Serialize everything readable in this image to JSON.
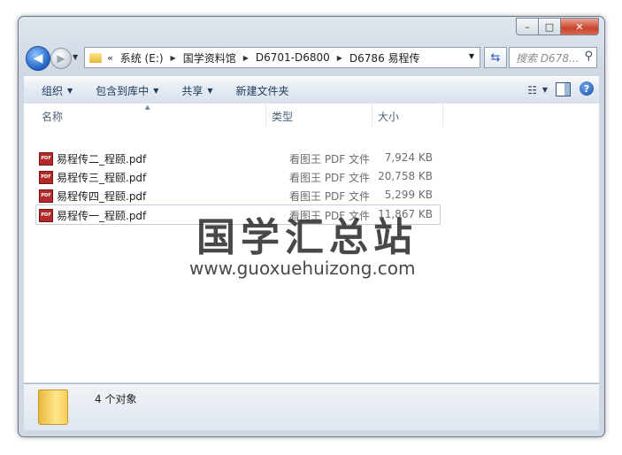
{
  "window": {
    "caption": {
      "minimize": "–",
      "maximize": "□",
      "close": "✕"
    }
  },
  "navigation": {
    "back_glyph": "◀",
    "forward_glyph": "▶",
    "breadcrumbs": [
      "系统 (E:)",
      "国学资料馆",
      "D6701-D6800",
      "D6786 易程传"
    ],
    "search_placeholder": "搜索 D678..."
  },
  "toolbar": {
    "organize": "组织",
    "include_in_library": "包含到库中",
    "share": "共享",
    "new_folder": "新建文件夹"
  },
  "columns": {
    "name": "名称",
    "type": "类型",
    "size": "大小"
  },
  "files": [
    {
      "name": "易程传二_程颐.pdf",
      "type": "看图王 PDF 文件",
      "size": "7,924 KB"
    },
    {
      "name": "易程传三_程颐.pdf",
      "type": "看图王 PDF 文件",
      "size": "20,758 KB"
    },
    {
      "name": "易程传四_程颐.pdf",
      "type": "看图王 PDF 文件",
      "size": "5,299 KB"
    },
    {
      "name": "易程传一_程颐.pdf",
      "type": "看图王 PDF 文件",
      "size": "11,867 KB"
    }
  ],
  "file_icon_label": "PDF",
  "watermark": {
    "title": "国学汇总站",
    "url": "www.guoxuehuizong.com"
  },
  "status": {
    "count_text": "4 个对象"
  }
}
